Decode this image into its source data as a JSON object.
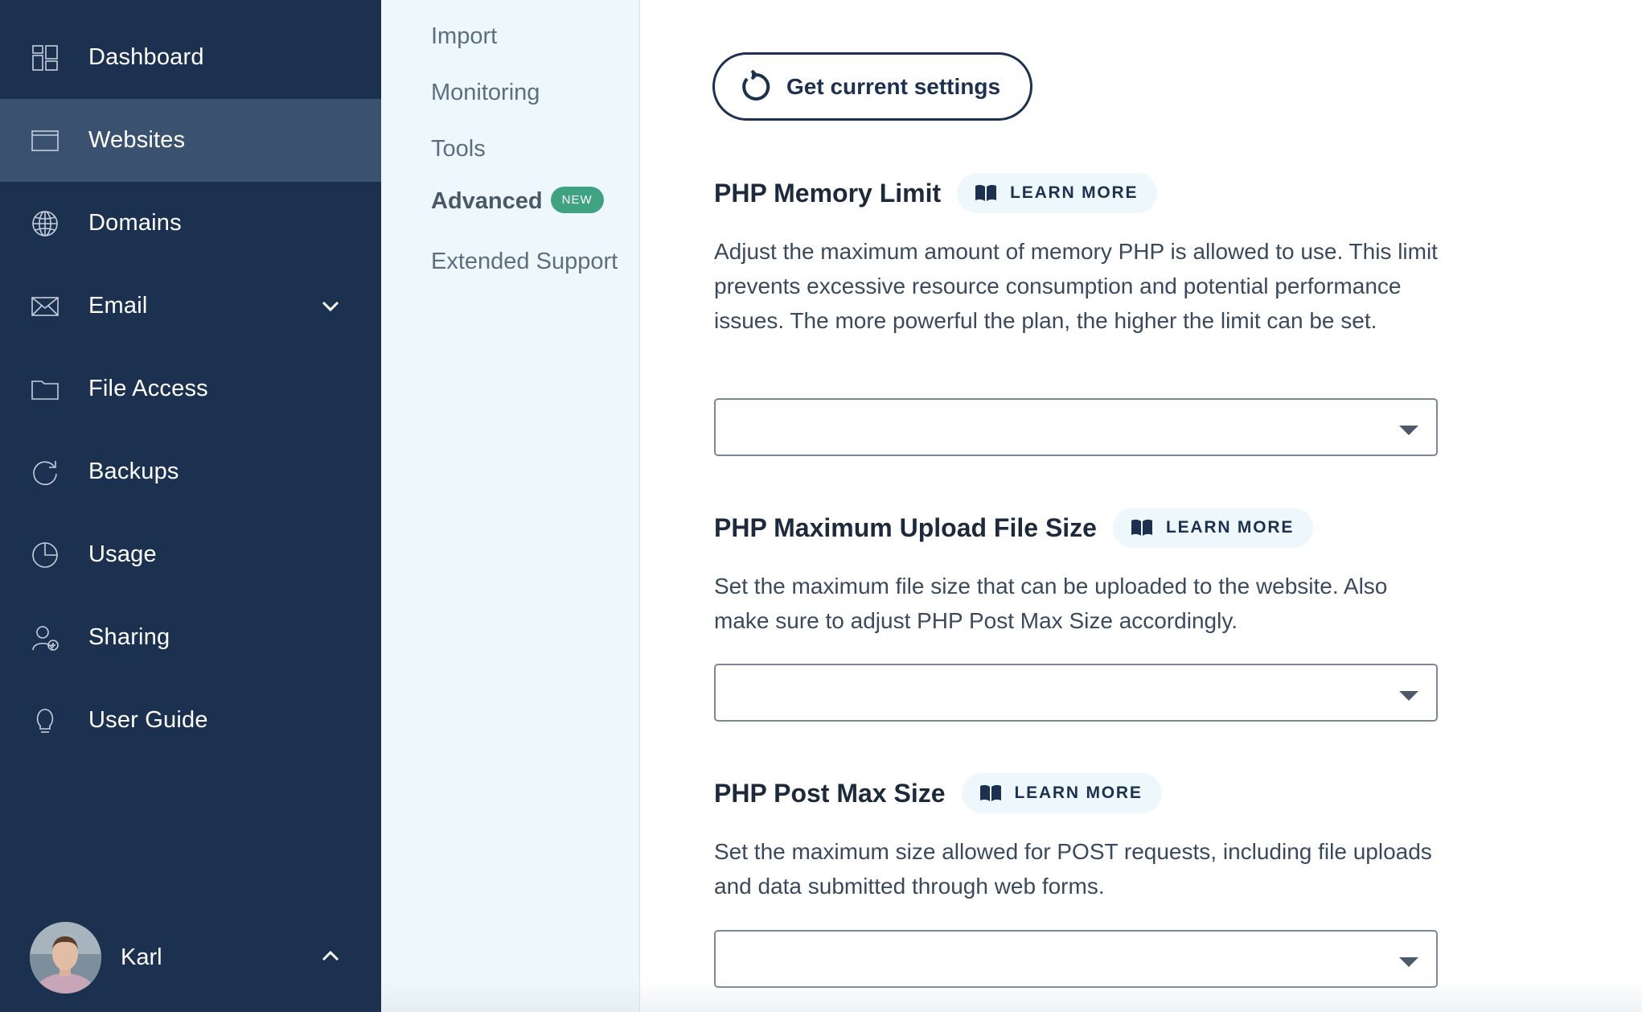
{
  "sidebar": {
    "items": [
      {
        "label": "Dashboard",
        "icon": "dashboard-icon"
      },
      {
        "label": "Websites",
        "icon": "browser-window-icon"
      },
      {
        "label": "Domains",
        "icon": "globe-icon"
      },
      {
        "label": "Email",
        "icon": "envelope-icon"
      },
      {
        "label": "File Access",
        "icon": "folder-icon"
      },
      {
        "label": "Backups",
        "icon": "refresh-circle-icon"
      },
      {
        "label": "Usage",
        "icon": "pie-chart-icon"
      },
      {
        "label": "Sharing",
        "icon": "user-add-icon"
      },
      {
        "label": "User Guide",
        "icon": "lightbulb-icon"
      }
    ],
    "active": "Websites",
    "user": {
      "name": "Karl"
    }
  },
  "subnav": {
    "items": [
      {
        "label": "Import"
      },
      {
        "label": "Monitoring"
      },
      {
        "label": "Tools"
      },
      {
        "label": "Advanced",
        "badge": "NEW"
      },
      {
        "label": "Extended Support"
      }
    ],
    "active": "Advanced"
  },
  "main": {
    "refresh_button": {
      "label": "Get current settings",
      "icon": "refresh-icon"
    },
    "sections": [
      {
        "title": "PHP Memory Limit",
        "learn_more": "LEARN MORE",
        "description": "Adjust the maximum amount of memory PHP is allowed to use. This limit prevents excessive resource consumption and potential performance issues. The more powerful the plan, the higher the limit can be set.",
        "select_value": ""
      },
      {
        "title": "PHP Maximum Upload File Size",
        "learn_more": "LEARN MORE",
        "description": "Set the maximum file size that can be uploaded to the website. Also make sure to adjust PHP Post Max Size accordingly.",
        "select_value": ""
      },
      {
        "title": "PHP Post Max Size",
        "learn_more": "LEARN MORE",
        "description": "Set the maximum size allowed for POST requests, including file uploads and data submitted through web forms.",
        "select_value": ""
      }
    ]
  },
  "colors": {
    "sidebar_bg": "#1c3150",
    "sidebar_active": "#3a5170",
    "subnav_bg": "#eef8fc",
    "badge_green": "#3fa382",
    "accent_navy": "#1c3150"
  }
}
